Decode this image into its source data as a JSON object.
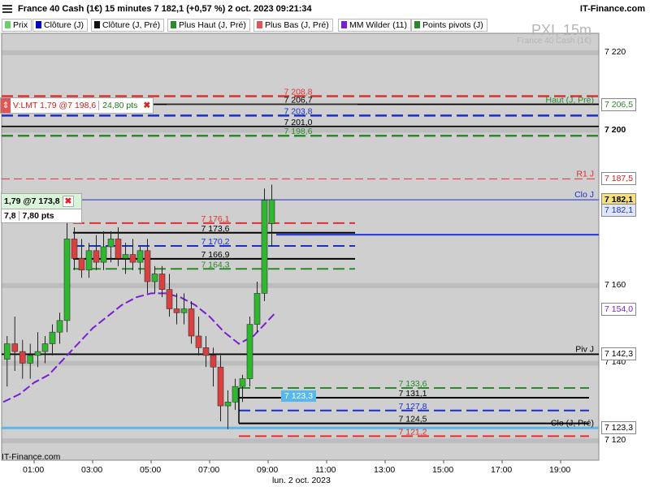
{
  "header": {
    "title": "France 40 Cash (1€) 15 minutes 7 182,1 (+0,57 %) 2 oct. 2023 09:21:34",
    "brand": "IT-Finance.com",
    "watermark_main": "PXI, 15m",
    "watermark_sub": "France 40 Cash (1€)"
  },
  "legend": [
    {
      "label": "Prix",
      "color": "#6ccf6c"
    },
    {
      "label": "Clôture (J)",
      "color": "#0000cc"
    },
    {
      "label": "Clôture (J, Pré)",
      "color": "#111111"
    },
    {
      "label": "Plus Haut (J, Pré)",
      "color": "#2a8a2a"
    },
    {
      "label": "Plus Bas (J, Pré)",
      "color": "#e05555"
    },
    {
      "label": "MM Wilder (11)",
      "color": "#7a1fd0"
    },
    {
      "label": "Points pivots (J)",
      "color": "#2a8a2a"
    }
  ],
  "order_box": {
    "text": "V:LMT  1,79 @7 198,6",
    "pts": "24,80 pts",
    "close": "✖"
  },
  "pos_box": {
    "text": "1,79 @7 173,8",
    "v1": "7,8",
    "v2": "7,80 pts",
    "close": "✖"
  },
  "footer": "IT-Finance.com",
  "date_label": "lun. 2 oct. 2023",
  "colors": {
    "bull": "#2fb82f",
    "bear": "#d94040",
    "ma": "#7a1fd0",
    "pivot_black": "#000000",
    "red": "#e03030",
    "blue": "#1a2fd0",
    "green": "#2a8a2a",
    "cyan": "#55b8ee",
    "bg": "#cfcfcf"
  },
  "chart_data": {
    "type": "candlestick",
    "ylim": [
      7115,
      7225
    ],
    "y_ticks": [
      "7 220",
      "7 200",
      "7 160",
      "7 140",
      "7 120"
    ],
    "y_tick_values": [
      7220,
      7200,
      7160,
      7140,
      7120
    ],
    "x_ticks": [
      "01:00",
      "03:00",
      "05:00",
      "07:00",
      "09:00",
      "11:00",
      "13:00",
      "15:00",
      "17:00",
      "19:00"
    ],
    "x_tick_hours": [
      1,
      3,
      5,
      7,
      9,
      11,
      13,
      15,
      17,
      19
    ],
    "candles": [
      {
        "t": 0.125,
        "o": 7141,
        "h": 7147,
        "l": 7134,
        "c": 7145
      },
      {
        "t": 0.375,
        "o": 7145,
        "h": 7152,
        "l": 7138,
        "c": 7143
      },
      {
        "t": 0.625,
        "o": 7143,
        "h": 7146,
        "l": 7136,
        "c": 7140
      },
      {
        "t": 0.875,
        "o": 7140,
        "h": 7145,
        "l": 7136,
        "c": 7142
      },
      {
        "t": 1.125,
        "o": 7142,
        "h": 7148,
        "l": 7139,
        "c": 7143
      },
      {
        "t": 1.375,
        "o": 7143,
        "h": 7147,
        "l": 7140,
        "c": 7145
      },
      {
        "t": 1.625,
        "o": 7145,
        "h": 7150,
        "l": 7142,
        "c": 7148
      },
      {
        "t": 1.875,
        "o": 7148,
        "h": 7153,
        "l": 7145,
        "c": 7151
      },
      {
        "t": 2.125,
        "o": 7151,
        "h": 7177,
        "l": 7148,
        "c": 7172
      },
      {
        "t": 2.375,
        "o": 7172,
        "h": 7175,
        "l": 7164,
        "c": 7167
      },
      {
        "t": 2.625,
        "o": 7167,
        "h": 7172,
        "l": 7162,
        "c": 7164
      },
      {
        "t": 2.875,
        "o": 7164,
        "h": 7171,
        "l": 7162,
        "c": 7169
      },
      {
        "t": 3.125,
        "o": 7169,
        "h": 7173,
        "l": 7164,
        "c": 7166
      },
      {
        "t": 3.375,
        "o": 7166,
        "h": 7174,
        "l": 7164,
        "c": 7170
      },
      {
        "t": 3.625,
        "o": 7170,
        "h": 7174,
        "l": 7166,
        "c": 7172
      },
      {
        "t": 3.875,
        "o": 7172,
        "h": 7175,
        "l": 7165,
        "c": 7167
      },
      {
        "t": 4.125,
        "o": 7167,
        "h": 7171,
        "l": 7163,
        "c": 7168
      },
      {
        "t": 4.375,
        "o": 7168,
        "h": 7172,
        "l": 7164,
        "c": 7166
      },
      {
        "t": 4.625,
        "o": 7166,
        "h": 7170,
        "l": 7163,
        "c": 7169
      },
      {
        "t": 4.875,
        "o": 7169,
        "h": 7172,
        "l": 7158,
        "c": 7161
      },
      {
        "t": 5.125,
        "o": 7161,
        "h": 7165,
        "l": 7158,
        "c": 7163
      },
      {
        "t": 5.375,
        "o": 7163,
        "h": 7165,
        "l": 7157,
        "c": 7159
      },
      {
        "t": 5.625,
        "o": 7159,
        "h": 7163,
        "l": 7152,
        "c": 7154
      },
      {
        "t": 5.875,
        "o": 7154,
        "h": 7158,
        "l": 7150,
        "c": 7153
      },
      {
        "t": 6.125,
        "o": 7153,
        "h": 7158,
        "l": 7150,
        "c": 7154
      },
      {
        "t": 6.375,
        "o": 7154,
        "h": 7156,
        "l": 7145,
        "c": 7147
      },
      {
        "t": 6.625,
        "o": 7147,
        "h": 7152,
        "l": 7142,
        "c": 7144
      },
      {
        "t": 6.875,
        "o": 7144,
        "h": 7147,
        "l": 7139,
        "c": 7142
      },
      {
        "t": 7.125,
        "o": 7142,
        "h": 7144,
        "l": 7134,
        "c": 7139
      },
      {
        "t": 7.375,
        "o": 7139,
        "h": 7142,
        "l": 7125,
        "c": 7129
      },
      {
        "t": 7.625,
        "o": 7129,
        "h": 7133,
        "l": 7123,
        "c": 7130
      },
      {
        "t": 7.875,
        "o": 7130,
        "h": 7136,
        "l": 7128,
        "c": 7134
      },
      {
        "t": 8.125,
        "o": 7134,
        "h": 7137,
        "l": 7130,
        "c": 7136
      },
      {
        "t": 8.375,
        "o": 7136,
        "h": 7152,
        "l": 7134,
        "c": 7150
      },
      {
        "t": 8.625,
        "o": 7150,
        "h": 7161,
        "l": 7148,
        "c": 7158
      },
      {
        "t": 8.875,
        "o": 7158,
        "h": 7185,
        "l": 7156,
        "c": 7182
      },
      {
        "t": 9.125,
        "o": 7176,
        "h": 7186,
        "l": 7170,
        "c": 7182.1
      }
    ],
    "ma_wilder_11": [
      [
        0.0,
        7130
      ],
      [
        0.5,
        7132
      ],
      [
        1.0,
        7135
      ],
      [
        1.5,
        7137
      ],
      [
        2.0,
        7141
      ],
      [
        2.5,
        7145
      ],
      [
        3.0,
        7149
      ],
      [
        3.5,
        7152
      ],
      [
        4.0,
        7155
      ],
      [
        4.5,
        7157
      ],
      [
        5.0,
        7158
      ],
      [
        5.5,
        7158
      ],
      [
        6.0,
        7157
      ],
      [
        6.5,
        7155
      ],
      [
        7.0,
        7152
      ],
      [
        7.5,
        7148
      ],
      [
        8.0,
        7145
      ],
      [
        8.5,
        7147
      ],
      [
        9.0,
        7151
      ],
      [
        9.25,
        7153
      ]
    ],
    "levels": [
      {
        "name": "Haut (J, Pré)",
        "value": 7208.8,
        "style": "dash",
        "color": "red",
        "label": "7 208,8"
      },
      {
        "name": "Clôture (J, Pré)",
        "value": 7206.7,
        "style": "solid",
        "color": "pivot_black",
        "label": "7 206,7"
      },
      {
        "name": "Clôture (J)",
        "value": 7203.8,
        "style": "dash",
        "color": "blue",
        "label": "7 203,8"
      },
      {
        "name": "",
        "value": 7201.0,
        "style": "solid",
        "color": "pivot_black",
        "label": "7 201,0"
      },
      {
        "name": "",
        "value": 7198.6,
        "style": "dash",
        "color": "green",
        "label": "7 198,6"
      },
      {
        "name": "R1 J",
        "value": 7187.5,
        "style": "thin",
        "color": "red",
        "label": "R1 J"
      },
      {
        "name": "Clo J",
        "value": 7182.1,
        "style": "thin",
        "color": "blue",
        "label": "Clo J"
      },
      {
        "name": "Piv J",
        "value": 7142.3,
        "style": "solid",
        "color": "pivot_black",
        "label": "Piv J"
      },
      {
        "name": "Clo (J, Pré)",
        "value": 7123.3,
        "style": "solid",
        "color": "cyan",
        "label": "Clo (J, Pré)"
      }
    ],
    "box_levels_mid": [
      {
        "value": 7176.1,
        "label": "7 176,1",
        "color": "red",
        "style": "dash"
      },
      {
        "value": 7173.6,
        "label": "7 173,6",
        "color": "pivot_black",
        "style": "solid"
      },
      {
        "value": 7170.2,
        "label": "7 170,2",
        "color": "blue",
        "style": "dash"
      },
      {
        "value": 7166.9,
        "label": "7 166,9",
        "color": "pivot_black",
        "style": "solid"
      },
      {
        "value": 7164.3,
        "label": "7 164,3",
        "color": "green",
        "style": "dash"
      }
    ],
    "box_levels_low": [
      {
        "value": 7133.6,
        "label": "7 133,6",
        "color": "green",
        "style": "dash"
      },
      {
        "value": 7131.1,
        "label": "7 131,1",
        "color": "pivot_black",
        "style": "solid"
      },
      {
        "value": 7127.8,
        "label": "7 127,8",
        "color": "blue",
        "style": "dash"
      },
      {
        "value": 7124.5,
        "label": "7 124,5",
        "color": "pivot_black",
        "style": "solid"
      },
      {
        "value": 7121.2,
        "label": "7 121,2",
        "color": "red",
        "style": "dash"
      }
    ],
    "right_labels": [
      {
        "value": 7206.5,
        "label": "7 206,5",
        "color": "green"
      },
      {
        "value": 7200,
        "label": "7 200",
        "color": "bold"
      },
      {
        "value": 7187.5,
        "label": "7 187,5",
        "color": "red"
      },
      {
        "value": 7182.1,
        "label": "7 182,1",
        "color": "hl"
      },
      {
        "value": 7179.5,
        "label": "7 182,1",
        "color": "blue"
      },
      {
        "value": 7154.0,
        "label": "7 154,0",
        "color": "purple"
      },
      {
        "value": 7142.3,
        "label": "7 142,3",
        "color": "black"
      },
      {
        "value": 7123.3,
        "label": "7 123,3",
        "color": "black"
      }
    ],
    "clo_callout": "7 123,3",
    "haut_label": "Haut (J, Pré)"
  }
}
